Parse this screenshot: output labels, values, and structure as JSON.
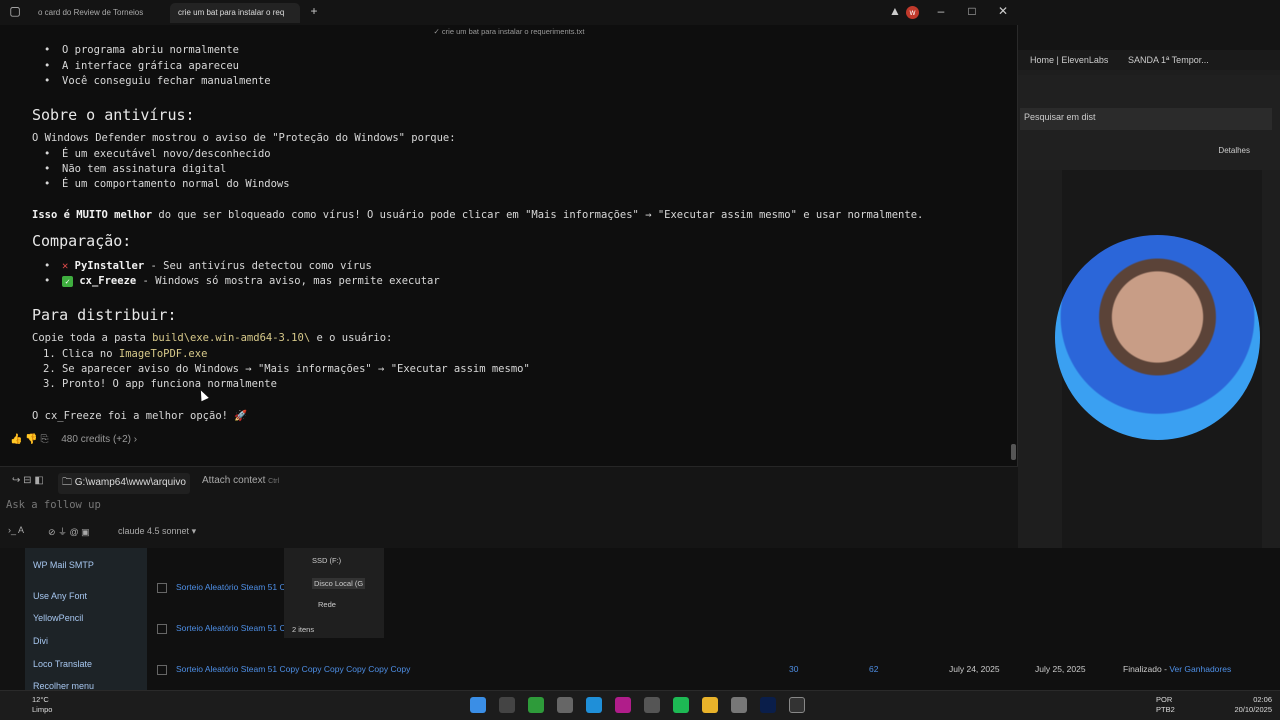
{
  "browser": {
    "tabs": [
      {
        "label": "o card do Review de Torneios"
      },
      {
        "label": "crie um bat para instalar o req"
      }
    ],
    "subtitle": "✓ crie um bat para instalar o requeriments.txt",
    "bookmarks": [
      "Home | ElevenLabs",
      "SANDA 1ª Tempor..."
    ],
    "explorer_search_placeholder": "Pesquisar em dist",
    "details_label": "Detalhes"
  },
  "chat": {
    "top_bullets": [
      "O programa abriu normalmente",
      "A interface gráfica apareceu",
      "Você conseguiu fechar manualmente"
    ],
    "antivirus_heading": "Sobre o antivírus:",
    "antivirus_intro": "O Windows Defender mostrou o aviso de \"Proteção do Windows\" porque:",
    "antivirus_bullets": [
      "É um executável novo/desconhecido",
      "Não tem assinatura digital",
      "É um comportamento normal do Windows"
    ],
    "better_bold": "Isso é MUITO melhor",
    "better_rest": " do que ser bloqueado como vírus! O usuário pode clicar em \"Mais informações\" → \"Executar assim mesmo\" e usar normalmente.",
    "comparison_heading": "Comparação:",
    "comparison": [
      {
        "name": "PyInstaller",
        "text": " - Seu antivírus detectou como vírus",
        "status": "x"
      },
      {
        "name": "cx_Freeze",
        "text": " - Windows só mostra aviso, mas permite executar",
        "status": "check"
      }
    ],
    "distribute_heading": "Para distribuir:",
    "distribute_intro_a": "Copie toda a pasta ",
    "distribute_path": "build\\exe.win-amd64-3.10\\",
    "distribute_intro_b": " e o usuário:",
    "steps": [
      {
        "n": "1.",
        "a": "Clica no ",
        "code": "ImageToPDF.exe",
        "b": ""
      },
      {
        "n": "2.",
        "a": "Se aparecer aviso do Windows → \"Mais informações\" → \"Executar assim mesmo\"",
        "code": "",
        "b": ""
      },
      {
        "n": "3.",
        "a": "Pronto! O app funciona normalmente",
        "code": "",
        "b": ""
      }
    ],
    "conclusion": "O cx_Freeze foi a melhor opção! 🚀",
    "credits": "480 credits (+2)"
  },
  "composer": {
    "path": "G:\\wamp64\\www\\arquivo",
    "attach": "Attach context",
    "attach_shortcut": "Ctrl",
    "placeholder": "Ask a follow up",
    "model": "claude 4.5 sonnet"
  },
  "wp": {
    "menu": [
      "WP Mail SMTP",
      "Use Any Font",
      "YellowPencil",
      "Divi",
      "Loco Translate",
      "Recolher menu"
    ],
    "rows": [
      {
        "title": "Sorteio Aleatório Steam 51 C"
      },
      {
        "title": "Sorteio Aleatório Steam 51 C"
      },
      {
        "title": "Sorteio Aleatório Steam 51 Copy Copy Copy Copy Copy Copy",
        "a": "30",
        "b": "62",
        "start": "July 24, 2025",
        "end": "July 25, 2025",
        "status": "Finalizado - ",
        "link": "Ver Ganhadores"
      }
    ],
    "tree": [
      "SSD (F:)",
      "Disco Local (G",
      "Rede"
    ],
    "items_count": "2 itens"
  },
  "taskbar": {
    "temp": "12°C",
    "weather": "Limpo",
    "lang1": "POR",
    "lang2": "PTB2",
    "time": "02:06",
    "date": "20/10/2025"
  },
  "colors": {
    "accent": "#3fae3f",
    "link": "#4e8fe6",
    "code": "#d7c98a"
  }
}
